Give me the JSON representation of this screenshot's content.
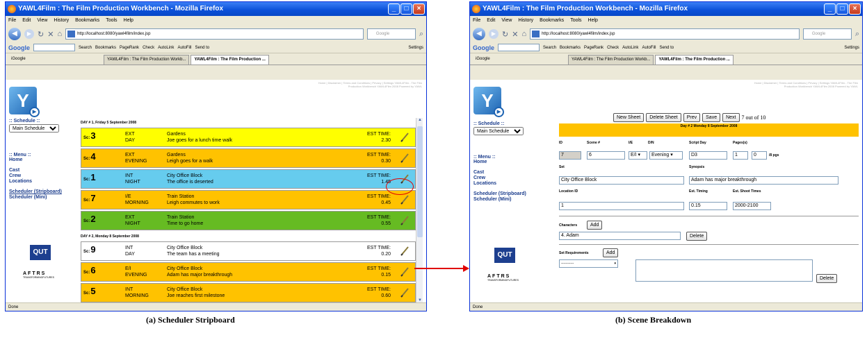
{
  "browser": {
    "window_title": "YAWL4Film : The Film Production Workbench - Mozilla Firefox",
    "menu": [
      "File",
      "Edit",
      "View",
      "History",
      "Bookmarks",
      "Tools",
      "Help"
    ],
    "url": "http://localhost:8080/yawl4film/index.jsp",
    "search_placeholder": "Google",
    "google_toolbar": {
      "logo": "Google",
      "search_button": "Search",
      "bookmarks": "Bookmarks",
      "pagerank": "PageRank",
      "check": "Check",
      "autolink": "AutoLink",
      "autofill": "AutoFill",
      "send_to": "Send to",
      "settings": "Settings"
    },
    "tabs": {
      "igoogle": "iGoogle",
      "tab1": "YAWL4Film : The Film Production Workb...",
      "tab2": "YAWL4Film : The Film Production ..."
    },
    "status": "Done"
  },
  "app": {
    "top_links": "Home | Disclaimer | Terms and Conditions | Privacy | Settings YAWL4Film - The Film Production Workbench YAWL4Film 2008 Powered by YAWL",
    "schedule_heading": ":: Schedule ::",
    "schedule_value": "Main Schedule",
    "menu_heading": ":: Menu ::",
    "menu_items": {
      "home": "Home",
      "cast": "Cast",
      "crew": "Crew",
      "locations": "Locations",
      "stripboard": "Scheduler (Stripboard)",
      "mini": "Scheduler (Mini)"
    },
    "qut_logo": "QUT",
    "aftrs_logo": "AFTRS",
    "aftrs_sub": "TRANSFORMINGFUTURES"
  },
  "stripboard": {
    "sc_prefix": "Sc:",
    "est_label": "EST TIME:",
    "days": [
      {
        "header": "DAY # 1, Friday 5 September 2008",
        "scenes": [
          {
            "num": "3",
            "ie": "EXT",
            "dn": "DAY",
            "set": "Gardens",
            "synopsis": "Joe goes for a lunch time walk",
            "est": "2.30",
            "color": "#ffff00"
          },
          {
            "num": "4",
            "ie": "EXT",
            "dn": "EVENING",
            "set": "Gardens",
            "synopsis": "Leigh goes for a walk",
            "est": "0.30",
            "color": "#ffc200"
          },
          {
            "num": "1",
            "ie": "INT",
            "dn": "NIGHT",
            "set": "City Office Block",
            "synopsis": "The office is deserted",
            "est": "1.45",
            "color": "#66ccee"
          },
          {
            "num": "7",
            "ie": "I/E",
            "dn": "MORNING",
            "set": "Train Station",
            "synopsis": "Leigh commutes to work",
            "est": "0.45",
            "color": "#ffc200"
          },
          {
            "num": "2",
            "ie": "EXT",
            "dn": "NIGHT",
            "set": "Train Station",
            "synopsis": "Time to go home",
            "est": "0.55",
            "color": "#66bb22"
          }
        ]
      },
      {
        "header": "DAY # 2, Monday 8 September 2008",
        "scenes": [
          {
            "num": "9",
            "ie": "INT",
            "dn": "DAY",
            "set": "City Office Block",
            "synopsis": "The team has a meeting",
            "est": "0.20",
            "color": "#ffffff"
          },
          {
            "num": "6",
            "ie": "E/I",
            "dn": "EVENING",
            "set": "City Office Block",
            "synopsis": "Adam has major breakthrough",
            "est": "0.15",
            "color": "#ffc200"
          },
          {
            "num": "5",
            "ie": "INT",
            "dn": "MORNING",
            "set": "City Office Block",
            "synopsis": "Joe reaches first milestone",
            "est": "0.60",
            "color": "#ffc200"
          }
        ]
      }
    ]
  },
  "breakdown": {
    "buttons": {
      "new": "New Sheet",
      "delete": "Delete Sheet",
      "prev": "Prev",
      "save": "Save",
      "next": "Next"
    },
    "position": "7 out of 10",
    "day_header": "Day # 2 Monday 8 September 2008",
    "labels": {
      "id": "ID",
      "scene": "Scene #",
      "ie": "I/E",
      "dn": "D/N",
      "script_day": "Script Day",
      "pages": "Pages(s)",
      "set": "Set",
      "synopsis": "Synopsis",
      "location_id": "Location ID",
      "est_timing": "Est. Timing",
      "est_shoot": "Est. Shoot Times",
      "characters": "Characters",
      "set_requirements": "Set Requirements",
      "pgs_suffix": "/8 pgs",
      "add": "Add",
      "delete": "Delete"
    },
    "values": {
      "id": "7",
      "scene": "6",
      "ie": "E/I",
      "dn": "Evening",
      "script_day": "D3",
      "pages": "1",
      "pages_eighths": "0",
      "set": "City Office Block",
      "synopsis": "Adam has major breakthrough",
      "location_id": "1",
      "est_timing": "0.15",
      "est_shoot": "2000-2100",
      "character": "4. Adam",
      "set_req_select": "-----------"
    }
  },
  "captions": {
    "a": "(a) Scheduler Stripboard",
    "b": "(b) Scene Breakdown"
  }
}
